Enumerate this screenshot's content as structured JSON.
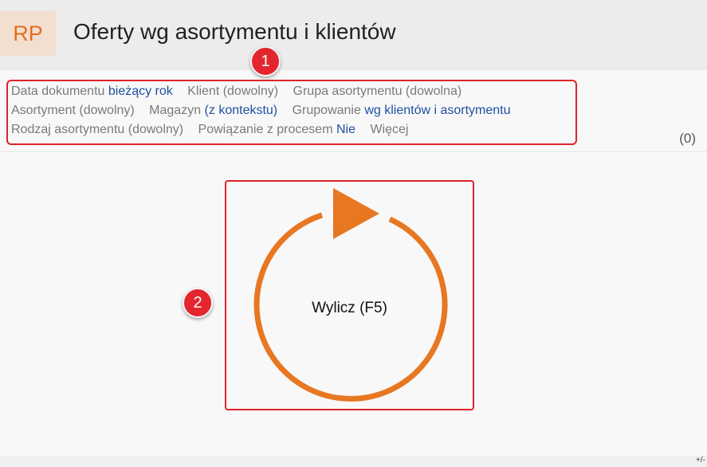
{
  "header": {
    "badge": "RP",
    "title": "Oferty wg asortymentu i klientów"
  },
  "filters": {
    "rows": [
      [
        {
          "label": "Data dokumentu",
          "value": "bieżący rok"
        },
        {
          "label": "Klient (dowolny)",
          "value": ""
        },
        {
          "label": "Grupa asortymentu (dowolna)",
          "value": ""
        }
      ],
      [
        {
          "label": "Asortyment (dowolny)",
          "value": ""
        },
        {
          "label": "Magazyn",
          "value": "(z kontekstu)"
        },
        {
          "label": "Grupowanie",
          "value": "wg klientów i asortymentu"
        }
      ],
      [
        {
          "label": "Rodzaj asortymentu (dowolny)",
          "value": ""
        },
        {
          "label": "Powiązanie z procesem",
          "value": "Nie"
        },
        {
          "label": "Więcej",
          "value": ""
        }
      ]
    ],
    "count": "(0)"
  },
  "calculate": {
    "label": "Wylicz (F5)"
  },
  "callouts": {
    "one": "1",
    "two": "2"
  },
  "footer": {
    "toggle": "+/-"
  },
  "colors": {
    "accent": "#e87722",
    "highlight": "#e0232b",
    "link": "#1f4fa0"
  }
}
